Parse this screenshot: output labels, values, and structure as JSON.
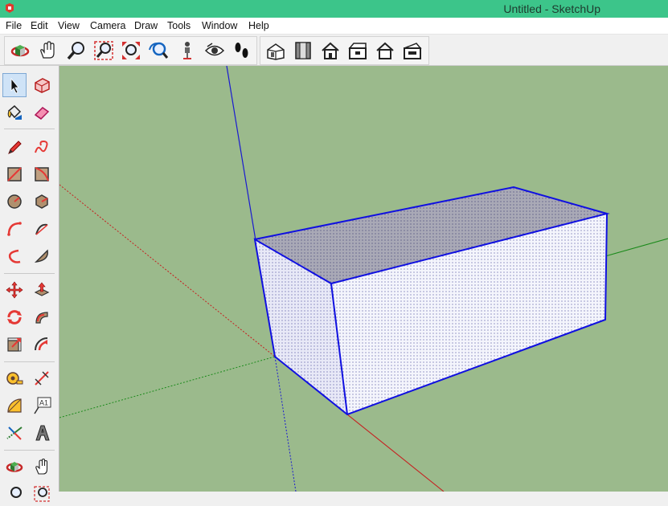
{
  "window": {
    "title": "Untitled - SketchUp",
    "app_icon": "sketchup-logo-icon"
  },
  "menu": [
    "File",
    "Edit",
    "View",
    "Camera",
    "Draw",
    "Tools",
    "Window",
    "Help"
  ],
  "camera_toolbar": [
    "orbit-icon",
    "pan-hand-icon",
    "zoom-icon",
    "zoom-window-icon",
    "zoom-extents-icon",
    "previous-view-icon",
    "position-camera-icon",
    "look-around-icon",
    "walk-icon"
  ],
  "views_toolbar": [
    "iso-view-icon",
    "top-view-icon",
    "front-view-icon",
    "right-view-icon",
    "back-view-icon",
    "left-view-icon"
  ],
  "left_toolbar": [
    "select-arrow-icon",
    "make-component-icon",
    "paint-bucket-icon",
    "eraser-icon",
    "pencil-line-icon",
    "freehand-icon",
    "rectangle-icon",
    "rotated-rectangle-icon",
    "circle-icon",
    "polygon-icon",
    "arc-icon",
    "two-point-arc-icon",
    "three-point-arc-icon",
    "pie-icon",
    "move-icon",
    "push-pull-icon",
    "rotate-icon",
    "follow-me-icon",
    "scale-icon",
    "offset-icon",
    "tape-measure-icon",
    "dimension-icon",
    "protractor-icon",
    "text-label-icon",
    "axes-icon",
    "3d-text-icon",
    "orbit-icon",
    "pan-hand-icon"
  ],
  "left_toolbar_label_glyph": "A1",
  "colors": {
    "viewport": "#9bba8c",
    "edge_selected": "#1010e0",
    "titlebar": "#3cc58a"
  }
}
